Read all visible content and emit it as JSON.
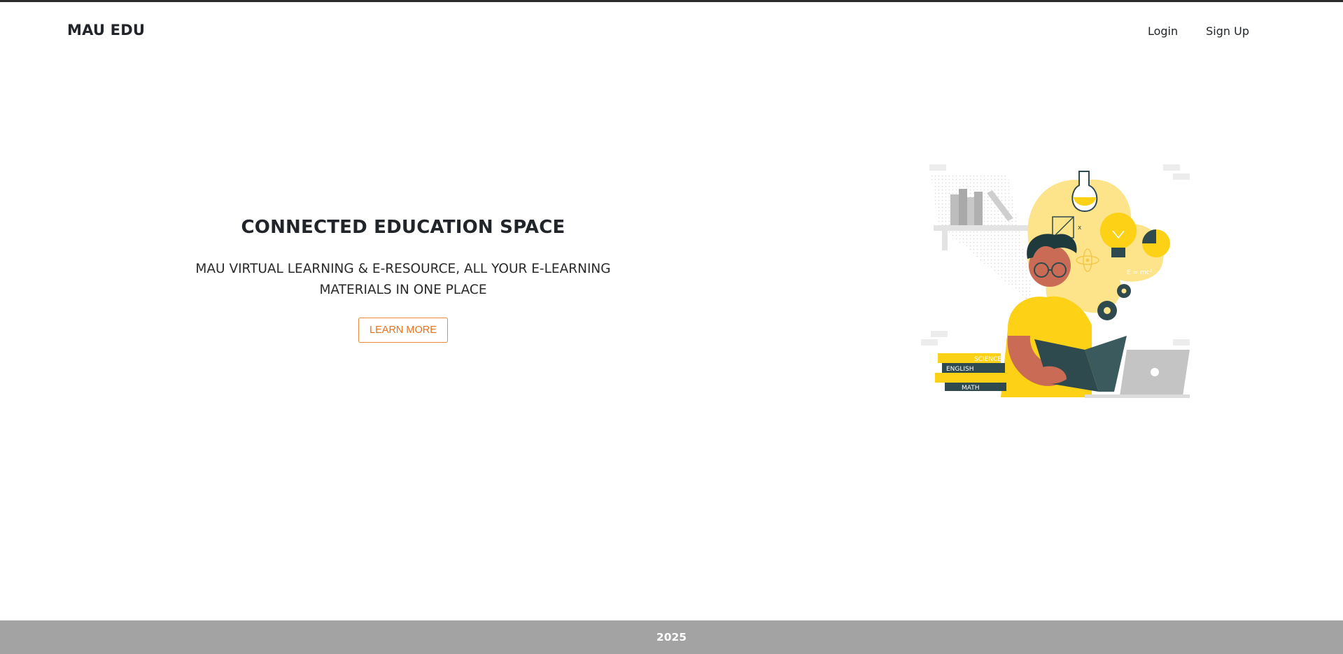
{
  "brand": "MAU EDU",
  "nav": {
    "login": "Login",
    "signup": "Sign Up"
  },
  "hero": {
    "title": "CONNECTED EDUCATION SPACE",
    "subtitle": "MAU VIRTUAL LEARNING & E-RESOURCE, ALL YOUR E-LEARNING MATERIALS IN ONE PLACE",
    "button": "LEARN MORE"
  },
  "illustration": {
    "books": {
      "science": "SCIENCE",
      "english": "ENGLISH",
      "math": "MATH"
    },
    "formula": "E = mc²",
    "colors": {
      "yellow": "#fcd116",
      "skin": "#c96b55",
      "dark": "#2f4a4e",
      "grey": "#c4c4c4"
    }
  },
  "footer": {
    "year": "2025"
  },
  "colors": {
    "accent": "#e8721c",
    "footer_bg": "#a3a3a3",
    "text": "#212529"
  }
}
